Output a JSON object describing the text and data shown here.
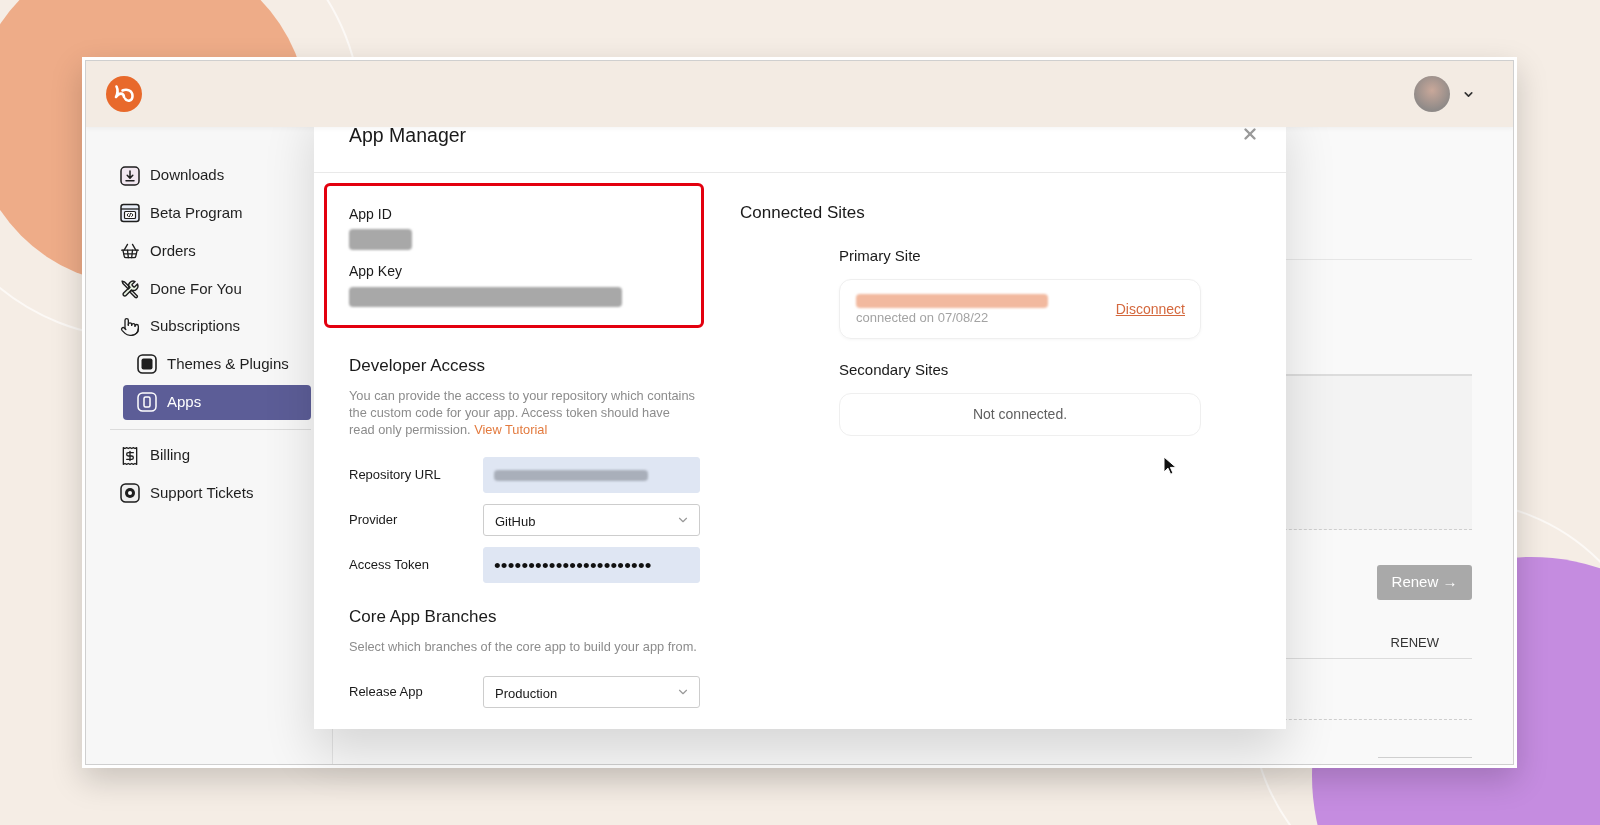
{
  "sidebar": {
    "groups": [
      {
        "items": [
          {
            "label": "Downloads",
            "selected": false
          },
          {
            "label": "Beta Program",
            "selected": false
          },
          {
            "label": "Orders",
            "selected": false
          },
          {
            "label": "Done For You",
            "selected": false
          },
          {
            "label": "Subscriptions",
            "selected": false,
            "children": [
              {
                "label": "Themes & Plugins",
                "selected": false
              },
              {
                "label": "Apps",
                "selected": true
              }
            ]
          }
        ]
      },
      {
        "items": [
          {
            "label": "Billing",
            "selected": false
          },
          {
            "label": "Support Tickets",
            "selected": false
          }
        ]
      }
    ]
  },
  "page": {
    "renew_button": {
      "label": "Renew →",
      "disabled": true
    },
    "table_headers": [
      "RENEW"
    ]
  },
  "modal": {
    "title": "App Manager",
    "credentials": {
      "highlighted": true,
      "items": [
        {
          "label": "App ID",
          "redacted": true
        },
        {
          "label": "App Key",
          "redacted": true
        }
      ]
    },
    "developer_access": {
      "title": "Developer Access",
      "description": "You can provide the access to your repository which contains the custom code for your app. Access token should have read only permission.",
      "link": "View Tutorial",
      "fields": [
        {
          "label": "Repository URL",
          "kind": "text",
          "redacted": true,
          "autofilled": true
        },
        {
          "label": "Provider",
          "kind": "select",
          "value": "GitHub",
          "redacted": false,
          "autofilled": false
        },
        {
          "label": "Access Token",
          "kind": "password",
          "value": "•••••••••••••••••••••••",
          "redacted": false,
          "autofilled": true
        }
      ]
    },
    "core_app_branches": {
      "title": "Core App Branches",
      "description": "Select which branches of the core app to build your app from.",
      "fields": [
        {
          "label": "Release App",
          "kind": "select",
          "value": "Production",
          "redacted": false,
          "autofilled": false
        }
      ]
    },
    "connected_sites": {
      "title": "Connected Sites",
      "primary": {
        "title": "Primary Site",
        "redacted": true,
        "meta": "connected on 07/08/22",
        "action": "Disconnect"
      },
      "secondary": {
        "title": "Secondary Sites",
        "empty_text": "Not connected."
      }
    }
  }
}
